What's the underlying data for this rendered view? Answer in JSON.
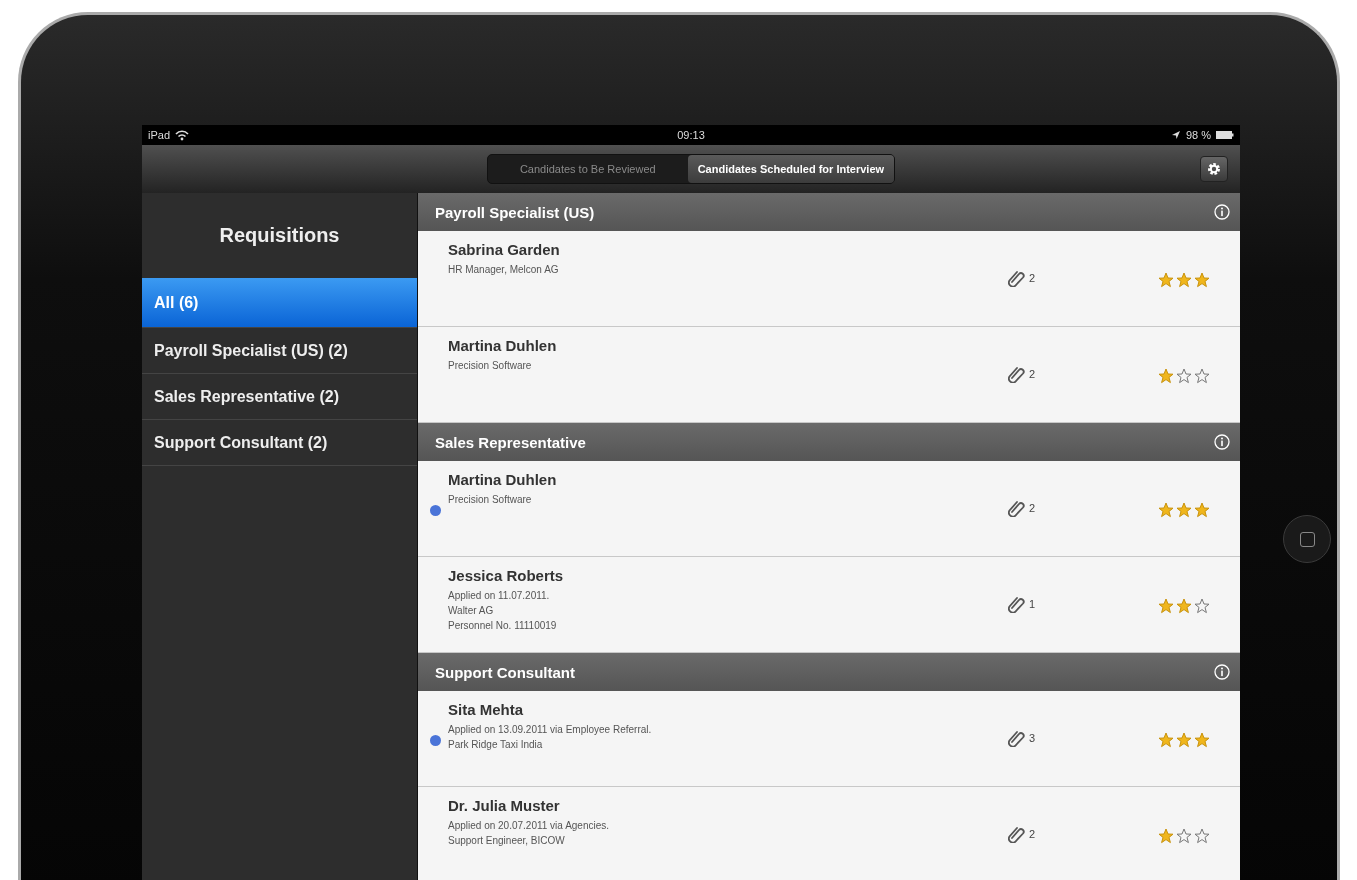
{
  "status_bar": {
    "carrier": "iPad",
    "time": "09:13",
    "battery": "98 %"
  },
  "toolbar": {
    "segments": [
      {
        "label": "Candidates to Be Reviewed",
        "selected": false
      },
      {
        "label": "Candidates Scheduled for Interview",
        "selected": true
      }
    ]
  },
  "sidebar": {
    "title": "Requisitions",
    "items": [
      {
        "label": "All (6)",
        "selected": true
      },
      {
        "label": "Payroll Specialist (US) (2)",
        "selected": false
      },
      {
        "label": "Sales Representative (2)",
        "selected": false
      },
      {
        "label": "Support Consultant (2)",
        "selected": false
      }
    ]
  },
  "sections": [
    {
      "title": "Payroll Specialist (US)",
      "rows": [
        {
          "name": "Sabrina Garden",
          "lines": [
            "HR Manager, Melcon AG"
          ],
          "unread": false,
          "attachments": "2",
          "stars": 3
        },
        {
          "name": "Martina Duhlen",
          "lines": [
            "Precision Software"
          ],
          "unread": false,
          "attachments": "2",
          "stars": 1
        }
      ]
    },
    {
      "title": "Sales Representative",
      "rows": [
        {
          "name": "Martina Duhlen",
          "lines": [
            "Precision Software"
          ],
          "unread": true,
          "attachments": "2",
          "stars": 3
        },
        {
          "name": "Jessica Roberts",
          "lines": [
            "Applied on 11.07.2011.",
            "Walter AG",
            "Personnel No. 11110019"
          ],
          "unread": false,
          "attachments": "1",
          "stars": 2
        }
      ]
    },
    {
      "title": "Support Consultant",
      "rows": [
        {
          "name": "Sita Mehta",
          "lines": [
            "Applied on 13.09.2011 via Employee Referral.",
            "Park Ridge Taxi India"
          ],
          "unread": true,
          "attachments": "3",
          "stars": 3
        },
        {
          "name": "Dr. Julia Muster",
          "lines": [
            "Applied on 20.07.2011 via Agencies.",
            "Support Engineer, BICOW"
          ],
          "unread": false,
          "attachments": "2",
          "stars": 1
        }
      ]
    }
  ]
}
